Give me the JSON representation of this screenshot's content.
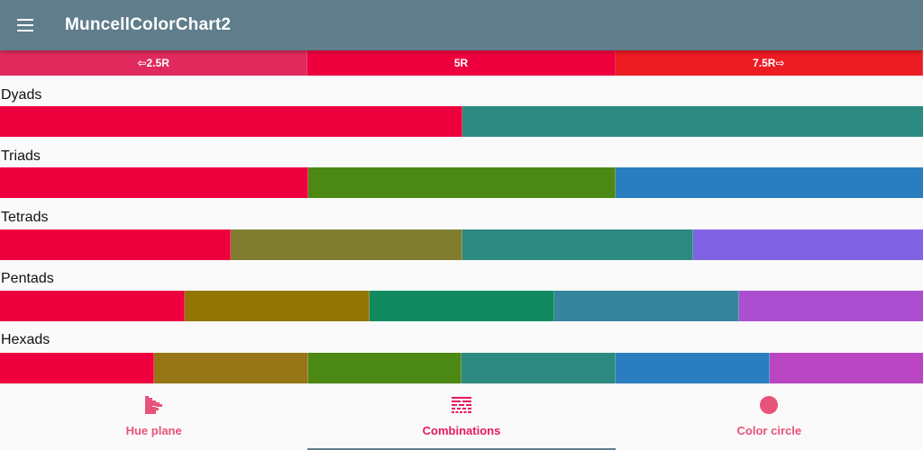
{
  "appbar": {
    "title": "MuncellColorChart2",
    "menu_icon": "hamburger-menu-icon"
  },
  "hue_tabs": [
    {
      "label": "⇦2.5R",
      "color": "#e02a5e"
    },
    {
      "label": "5R",
      "color": "#ee003e"
    },
    {
      "label": "7.5R⇨",
      "color": "#ec1c23"
    }
  ],
  "groups": [
    {
      "label": "Dyads",
      "colors": [
        "#ee003e",
        "#2c8a80"
      ]
    },
    {
      "label": "Triads",
      "colors": [
        "#ee003e",
        "#4c8814",
        "#2a7ebf"
      ]
    },
    {
      "label": "Tetrads",
      "colors": [
        "#ee003e",
        "#817d2e",
        "#2c8a80",
        "#8063e3"
      ]
    },
    {
      "label": "Pentads",
      "colors": [
        "#ee003e",
        "#927604",
        "#118a62",
        "#37849d",
        "#ab4fd0"
      ]
    },
    {
      "label": "Hexads",
      "colors": [
        "#ee003e",
        "#967516",
        "#4c8814",
        "#2c8a80",
        "#2a7ebf",
        "#b945c3"
      ]
    }
  ],
  "bottom_nav": {
    "items": [
      {
        "label": "Hue plane",
        "icon": "hue-plane-icon",
        "active": false
      },
      {
        "label": "Combinations",
        "icon": "combinations-grid-icon",
        "active": true
      },
      {
        "label": "Color circle",
        "icon": "color-circle-icon",
        "active": false
      }
    ],
    "accent_color": "#e8195a",
    "inactive_color": "#e8537a",
    "indicator_color": "#607d8b"
  },
  "theme": {
    "appbar_color": "#607d8b",
    "background": "#fafafa"
  }
}
